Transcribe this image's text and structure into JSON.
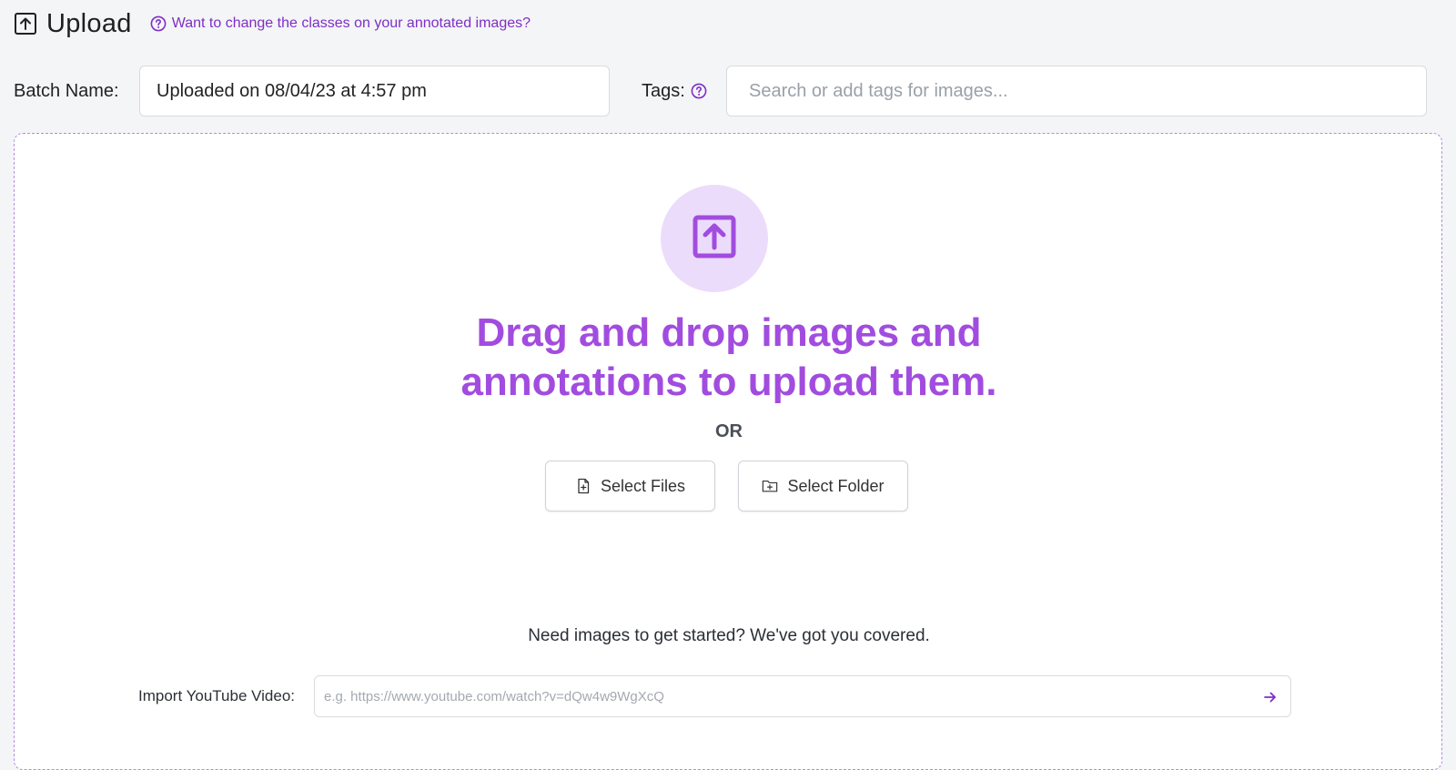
{
  "header": {
    "title": "Upload",
    "help_link": "Want to change the classes on your annotated images?"
  },
  "batch": {
    "label": "Batch Name:",
    "value": "Uploaded on 08/04/23 at 4:57 pm"
  },
  "tags": {
    "label": "Tags:",
    "placeholder": "Search or add tags for images..."
  },
  "dropzone": {
    "heading_line1": "Drag and drop images and",
    "heading_line2": "annotations to upload them.",
    "or_label": "OR",
    "select_files_label": "Select Files",
    "select_folder_label": "Select Folder"
  },
  "starter": {
    "text": "Need images to get started? We've got you covered.",
    "youtube_label": "Import YouTube Video:",
    "youtube_placeholder": "e.g. https://www.youtube.com/watch?v=dQw4w9WgXcQ"
  },
  "colors": {
    "accent": "#a24cdf",
    "link": "#7e2ec6",
    "circle_bg": "#ecdcfb"
  },
  "icons": {
    "upload": "upload-arrow-box-icon",
    "help": "question-circle-icon",
    "file": "file-plus-icon",
    "folder": "folder-plus-icon",
    "submit": "arrow-right-icon"
  }
}
